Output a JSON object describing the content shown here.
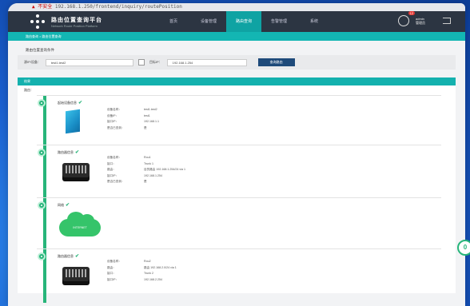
{
  "browser": {
    "url_security": "▲ 不安全",
    "url": "192.168.1.250/frontend/inquiry/routePosition"
  },
  "app": {
    "title": "路由位置查询平台",
    "subtitle": "Network Route Position Platform",
    "nav": [
      "首页",
      "设备管理",
      "路由查询",
      "告警管理",
      "系统"
    ],
    "active_nav": 2,
    "user_badge": "12",
    "user_lines": [
      "admin",
      "管理员"
    ]
  },
  "breadcrumb": "路由查询 > 路由位置查询",
  "search": {
    "title": "路由位置查询条件",
    "source_label": "源IP/设备：",
    "source_value": "test1.test2",
    "dest_label": "目标IP：",
    "dest_value": "192.168.1.254",
    "button": "查询路由"
  },
  "result": {
    "head": "结果",
    "route_label": "路由：",
    "nodes": [
      {
        "title": "起始设备信息",
        "rows": [
          {
            "k": "设备名称：",
            "v": "test1.test2"
          },
          {
            "k": "设备IP：",
            "v": "test1"
          },
          {
            "k": "接口IP：",
            "v": "192.168.1.1"
          },
          {
            "k": "是否已查到：",
            "v": "是"
          }
        ]
      },
      {
        "title": "路由器信息",
        "rows": [
          {
            "k": "设备名称：",
            "v": "Rou1"
          },
          {
            "k": "接口：",
            "v": "Trunk 1"
          },
          {
            "k": "路由：",
            "v": "目的路由 192.168.1.254/24 via 1"
          },
          {
            "k": "接口IP：",
            "v": "192.168.1.254"
          },
          {
            "k": "是否已查到：",
            "v": "是"
          }
        ]
      },
      {
        "title": "网络",
        "cloud_label": "INTERNET",
        "rows": []
      },
      {
        "title": "路由器信息",
        "rows": [
          {
            "k": "设备名称：",
            "v": "Rou2"
          },
          {
            "k": "路由：",
            "v": "路由 192.168.2.0/24 via 1"
          },
          {
            "k": "接口：",
            "v": "Trunk 2"
          },
          {
            "k": "接口IP：",
            "v": "192.168.2.254"
          }
        ]
      }
    ]
  },
  "fab_label": "0",
  "colors": {
    "accent": "#13b6b3",
    "route": "#27b57a",
    "nav_bg": "#2c3542"
  }
}
